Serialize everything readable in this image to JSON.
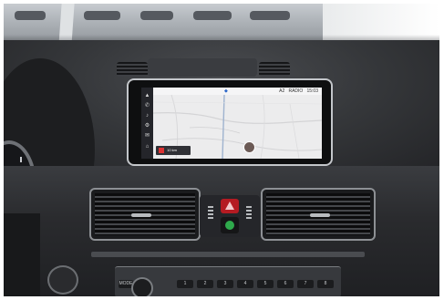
{
  "scene": {
    "description_icons": [
      "nav-icon",
      "phone-icon",
      "media-icon",
      "settings-icon",
      "home-icon"
    ]
  },
  "infotainment": {
    "status_badge": "A2",
    "radio_label": "RADIO",
    "clock": "15:03",
    "route_card_text": "10 km"
  },
  "colors": {
    "hazard": "#b41b22",
    "green_indicator": "#2faa4c",
    "screen_bg": "#eeeeef"
  },
  "radio_keys": [
    "1",
    "2",
    "3",
    "4",
    "5",
    "6",
    "7",
    "8"
  ],
  "radio_mode_label": "MODE"
}
